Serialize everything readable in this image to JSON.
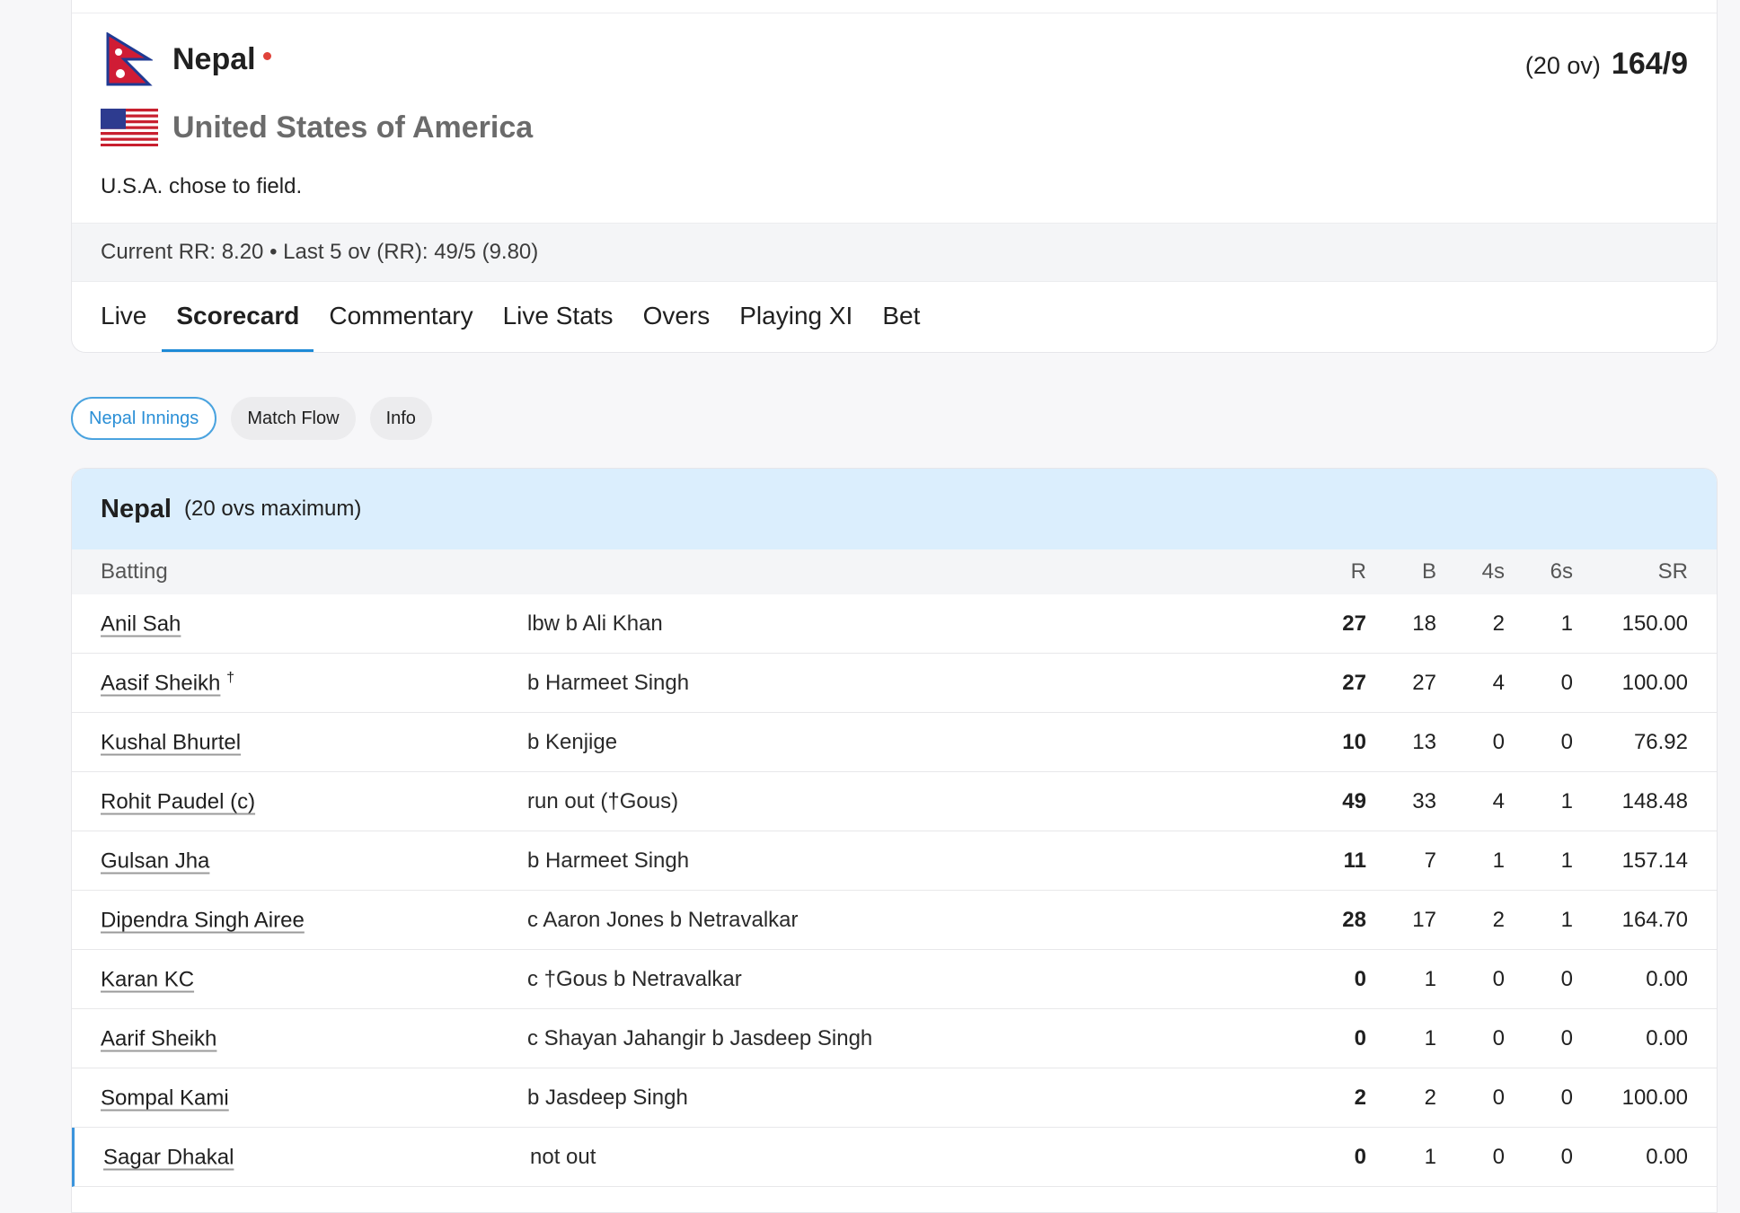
{
  "match": {
    "team1": {
      "name": "Nepal",
      "overs": "(20 ov)",
      "score": "164/9"
    },
    "team2": {
      "name": "United States of America"
    },
    "toss": "U.S.A. chose to field.",
    "run_rate": "Current RR: 8.20  •  Last 5 ov (RR): 49/5 (9.80)"
  },
  "tabs": [
    {
      "label": "Live"
    },
    {
      "label": "Scorecard",
      "active": true
    },
    {
      "label": "Commentary"
    },
    {
      "label": "Live Stats"
    },
    {
      "label": "Overs"
    },
    {
      "label": "Playing XI"
    },
    {
      "label": "Bet"
    }
  ],
  "pills": [
    {
      "label": "Nepal Innings",
      "active": true
    },
    {
      "label": "Match Flow"
    },
    {
      "label": "Info"
    }
  ],
  "innings": {
    "team": "Nepal",
    "max": "(20 ovs maximum)",
    "headers": {
      "batting": "Batting",
      "r": "R",
      "b": "B",
      "fours": "4s",
      "sixes": "6s",
      "sr": "SR"
    },
    "batters": [
      {
        "name": "Anil Sah",
        "mark": "",
        "dismissal": "lbw b Ali Khan",
        "r": "27",
        "b": "18",
        "fours": "2",
        "sixes": "1",
        "sr": "150.00"
      },
      {
        "name": "Aasif Sheikh",
        "mark": "†",
        "dismissal": "b Harmeet Singh",
        "r": "27",
        "b": "27",
        "fours": "4",
        "sixes": "0",
        "sr": "100.00"
      },
      {
        "name": "Kushal Bhurtel",
        "mark": "",
        "dismissal": "b Kenjige",
        "r": "10",
        "b": "13",
        "fours": "0",
        "sixes": "0",
        "sr": "76.92"
      },
      {
        "name": "Rohit Paudel (c)",
        "mark": "",
        "dismissal": "run out (†Gous)",
        "r": "49",
        "b": "33",
        "fours": "4",
        "sixes": "1",
        "sr": "148.48"
      },
      {
        "name": "Gulsan Jha",
        "mark": "",
        "dismissal": "b Harmeet Singh",
        "r": "11",
        "b": "7",
        "fours": "1",
        "sixes": "1",
        "sr": "157.14"
      },
      {
        "name": "Dipendra Singh Airee",
        "mark": "",
        "dismissal": "c Aaron Jones b Netravalkar",
        "r": "28",
        "b": "17",
        "fours": "2",
        "sixes": "1",
        "sr": "164.70"
      },
      {
        "name": "Karan KC",
        "mark": "",
        "dismissal": "c †Gous b Netravalkar",
        "r": "0",
        "b": "1",
        "fours": "0",
        "sixes": "0",
        "sr": "0.00"
      },
      {
        "name": "Aarif Sheikh",
        "mark": "",
        "dismissal": "c Shayan Jahangir b Jasdeep Singh",
        "r": "0",
        "b": "1",
        "fours": "0",
        "sixes": "0",
        "sr": "0.00"
      },
      {
        "name": "Sompal Kami",
        "mark": "",
        "dismissal": "b Jasdeep Singh",
        "r": "2",
        "b": "2",
        "fours": "0",
        "sixes": "0",
        "sr": "100.00"
      },
      {
        "name": "Sagar Dhakal",
        "mark": "",
        "dismissal": "not out",
        "r": "0",
        "b": "1",
        "fours": "0",
        "sixes": "0",
        "sr": "0.00"
      }
    ]
  },
  "colors": {
    "accent": "#1e8ad6",
    "header_bg": "#dbeefd",
    "live_dot": "#e0433a"
  },
  "icons": {
    "team1_flag": "nepal-flag-icon",
    "team2_flag": "usa-flag-icon"
  }
}
